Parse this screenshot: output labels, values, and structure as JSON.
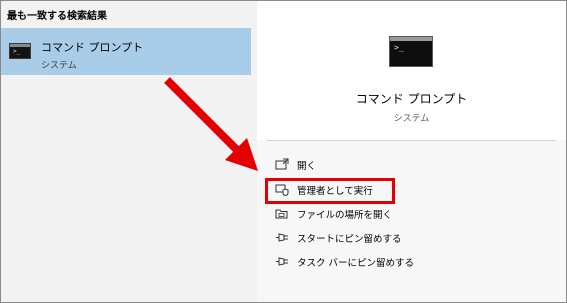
{
  "search_results": {
    "section_title": "最も一致する検索結果",
    "best_match": {
      "name": "コマンド プロンプト",
      "type": "システム",
      "icon": "command-prompt-icon"
    }
  },
  "detail": {
    "app_name": "コマンド プロンプト",
    "app_type": "システム",
    "icon": "command-prompt-icon",
    "actions": [
      {
        "label": "開く",
        "icon": "open-icon"
      },
      {
        "label": "管理者として実行",
        "icon": "run-as-admin-icon"
      },
      {
        "label": "ファイルの場所を開く",
        "icon": "folder-location-icon"
      },
      {
        "label": "スタートにピン留めする",
        "icon": "pin-icon"
      },
      {
        "label": "タスク バーにピン留めする",
        "icon": "pin-icon"
      }
    ]
  },
  "annotation": {
    "arrow_color": "#e40000",
    "highlight_color": "#e40000",
    "highlighted_action": "管理者として実行"
  },
  "colors": {
    "selected_row": "#a9cde9",
    "left_pane": "#f2f2f2",
    "right_pane": "#f7f7f7"
  }
}
